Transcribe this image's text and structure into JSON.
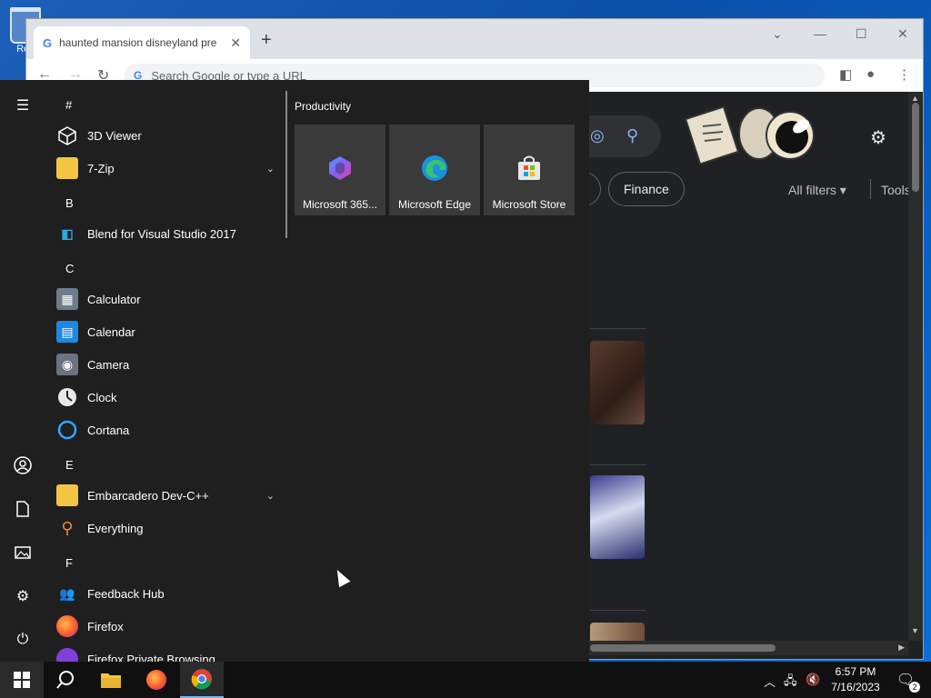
{
  "desktop": {
    "recycle_label": "Rec"
  },
  "chrome": {
    "tab_title": "haunted mansion disneyland pre",
    "tab_close": "✕",
    "new_tab": "+",
    "omnibox_placeholder": "Search Google or type a URL",
    "chip_finance": "Finance",
    "all_filters": "All filters",
    "tools": "Tools"
  },
  "start_menu": {
    "tiles_header": "Productivity",
    "tiles": [
      {
        "label": "Microsoft 365...",
        "icon": "microsoft-365-icon"
      },
      {
        "label": "Microsoft Edge",
        "icon": "edge-icon"
      },
      {
        "label": "Microsoft Store",
        "icon": "store-icon"
      }
    ],
    "headers": {
      "hash": "#",
      "b": "B",
      "c": "C",
      "e": "E",
      "f": "F"
    },
    "apps": {
      "viewer3d": "3D Viewer",
      "sevenzip": "7-Zip",
      "blend": "Blend for Visual Studio 2017",
      "calculator": "Calculator",
      "calendar": "Calendar",
      "camera": "Camera",
      "clock": "Clock",
      "cortana": "Cortana",
      "embarcadero": "Embarcadero Dev-C++",
      "everything": "Everything",
      "feedback": "Feedback Hub",
      "firefox": "Firefox",
      "firefox_private": "Firefox Private Browsing"
    }
  },
  "taskbar": {
    "time": "6:57 PM",
    "date": "7/16/2023",
    "notification_count": "2"
  },
  "colors": {
    "accent": "#0078d4",
    "start_bg": "#1f1f1f",
    "tile_bg": "#3a3a3a"
  }
}
